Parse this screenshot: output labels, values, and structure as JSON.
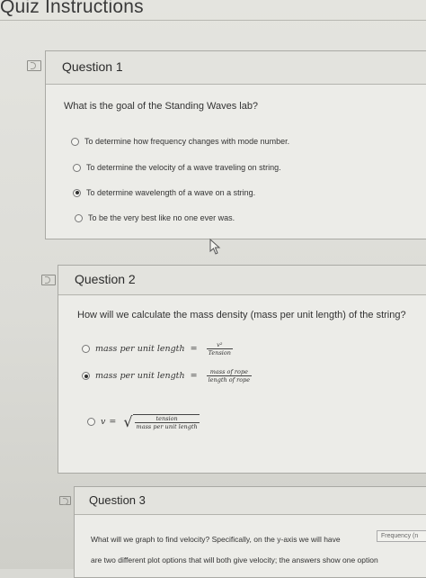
{
  "page": {
    "title": "Quiz Instructions"
  },
  "questions": [
    {
      "label": "Question 1",
      "prompt": "What is the goal of the Standing Waves lab?",
      "options": [
        {
          "text": "To determine how frequency changes with mode number.",
          "selected": false
        },
        {
          "text": "To determine the velocity of a wave traveling on string.",
          "selected": false
        },
        {
          "text": "To determine wavelength of a wave on a string.",
          "selected": true
        },
        {
          "text": "To be the very best like no one ever was.",
          "selected": false
        }
      ]
    },
    {
      "label": "Question 2",
      "prompt": "How will we calculate the mass density (mass per unit length) of the string?",
      "options": [
        {
          "lhs": "mass per unit length",
          "eq": "=",
          "num": "v²",
          "den": "Tension",
          "selected": false
        },
        {
          "lhs": "mass per unit length",
          "eq": "=",
          "num": "mass of rope",
          "den": "length of rope",
          "selected": true
        },
        {
          "lhs": "v",
          "eq": "=",
          "num": "tension",
          "den": "mass per unit length",
          "selected": false
        }
      ]
    },
    {
      "label": "Question 3",
      "prompt_line1": "What will we graph to find velocity? Specifically, on the y-axis we will have",
      "prompt_line2": "are two different plot options that will both give velocity; the answers show one option",
      "select_value": "Frequency (n"
    }
  ]
}
